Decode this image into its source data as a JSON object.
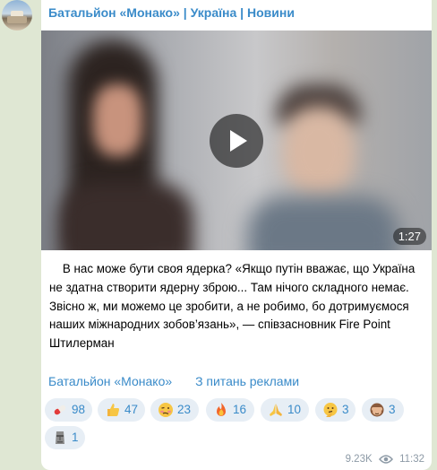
{
  "message": {
    "channel_name": "Батальйон «Монако» | Україна | Новини",
    "video": {
      "duration": "1:27"
    },
    "text": "    В нас може бути своя ядерка? «Якщо путін вважає, що Україна не здатна створити ядерну зброю... Там нічого складного немає. Звісно ж, ми можемо це зробити, а не робимо, бо дотримуємося наших міжнародних зобов’язань», — співзасновник Fire Point Штилерман",
    "links": [
      "Батальйон «Монако»",
      "З питань реклами"
    ],
    "reactions": [
      {
        "icon": "pill-icon",
        "count": "98"
      },
      {
        "icon": "thumbs-up-icon",
        "count": "47"
      },
      {
        "icon": "woozy-face-icon",
        "count": "23"
      },
      {
        "icon": "fire-icon",
        "count": "16"
      },
      {
        "icon": "folded-hands-icon",
        "count": "10"
      },
      {
        "icon": "thinking-face-icon",
        "count": "3"
      },
      {
        "icon": "see-no-evil-monkey-icon",
        "count": "3"
      },
      {
        "icon": "moai-icon",
        "count": "1"
      }
    ],
    "views": "9.23K",
    "time": "11:32"
  },
  "colors": {
    "accent": "#3a8bc9",
    "reaction_bg": "#e7eef5",
    "background": "#dfe7d3"
  }
}
